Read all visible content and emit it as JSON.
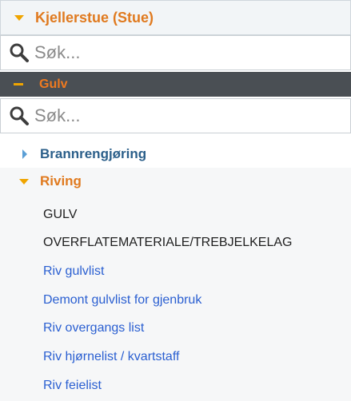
{
  "room": {
    "title": "Kjellerstue (Stue)",
    "expanded": true
  },
  "search_top": {
    "placeholder": "Søk..."
  },
  "group": {
    "title": "Gulv",
    "expanded": true
  },
  "search_group": {
    "placeholder": "Søk..."
  },
  "categories": [
    {
      "label": "Brannrengjøring",
      "expanded": false
    },
    {
      "label": "Riving",
      "expanded": true
    }
  ],
  "items": [
    {
      "label": "GULV",
      "type": "heading"
    },
    {
      "label": "OVERFLATEMATERIALE/TREBJELKELAG",
      "type": "heading"
    },
    {
      "label": "Riv gulvlist",
      "type": "link"
    },
    {
      "label": "Demont gulvlist for gjenbruk",
      "type": "link"
    },
    {
      "label": "Riv overgangs list",
      "type": "link"
    },
    {
      "label": "Riv hjørnelist / kvartstaff",
      "type": "link"
    },
    {
      "label": "Riv feielist",
      "type": "link"
    }
  ],
  "colors": {
    "accent_orange": "#e07a1f",
    "caret_yellow": "#f0a500",
    "link_blue": "#2a5fd1",
    "category_blue": "#2b5f8a",
    "group_bar": "#4a4f54"
  }
}
